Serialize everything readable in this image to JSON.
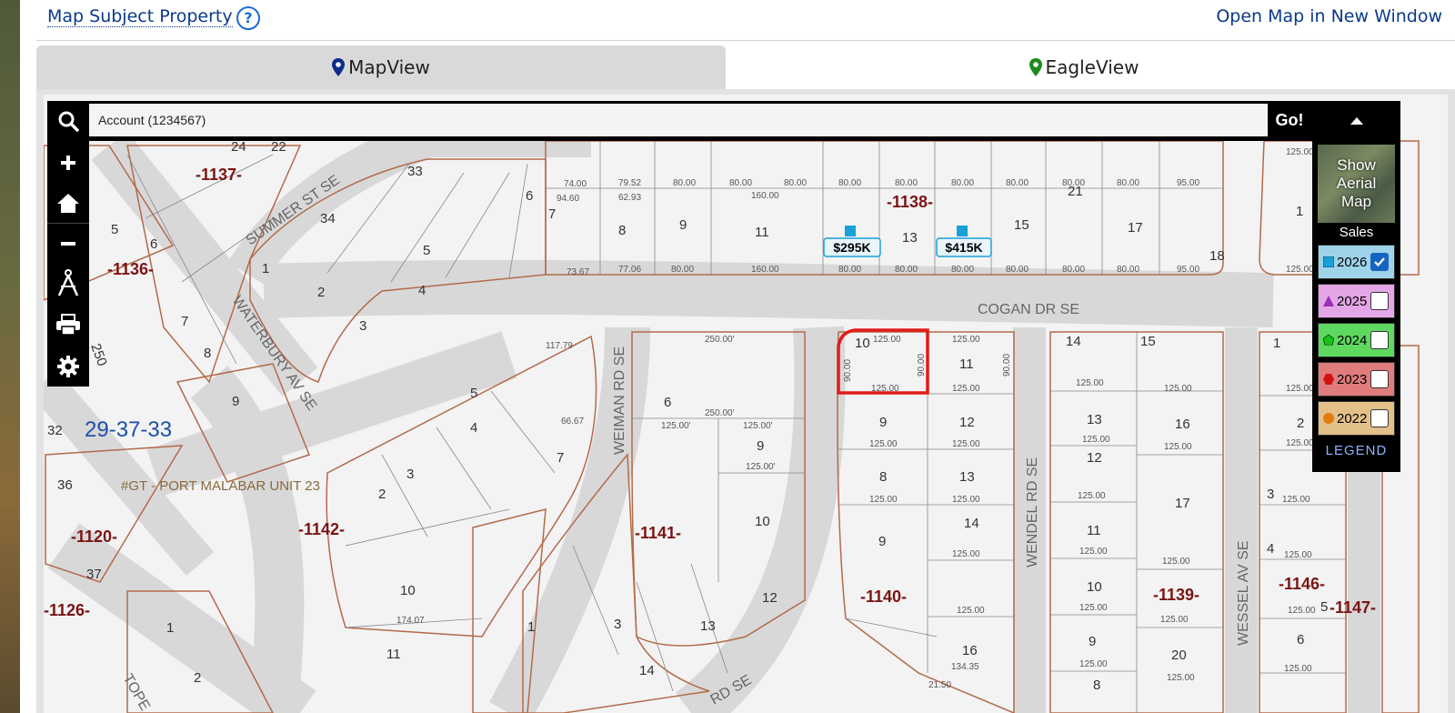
{
  "header": {
    "map_subject_label": "Map Subject Property",
    "help_glyph": "?",
    "open_new_window_label": "Open Map in New Window"
  },
  "tabs": [
    {
      "label": "MapView",
      "icon": "map-pin-icon",
      "color": "#0d2d8c",
      "active": true
    },
    {
      "label": "EagleView",
      "icon": "map-pin-icon",
      "color": "#1d8a1d",
      "active": false
    }
  ],
  "search": {
    "value": "Account (1234567)",
    "go_label": "Go!"
  },
  "toolbar": {
    "items": [
      "search-icon",
      "zoom-in-icon",
      "home-icon",
      "zoom-out-icon",
      "measure-icon",
      "print-icon",
      "gear-icon"
    ]
  },
  "right_panel": {
    "aerial_label_1": "Show",
    "aerial_label_2": "Aerial",
    "aerial_label_3": "Map",
    "sales_label": "Sales",
    "years": [
      {
        "year": "2026",
        "shape": "square",
        "marker_color": "#1aa0d8",
        "bg": "#9fd3ea",
        "checked": true
      },
      {
        "year": "2025",
        "shape": "triangle",
        "marker_color": "#9b2fb5",
        "bg": "#e4a6e6",
        "checked": false
      },
      {
        "year": "2024",
        "shape": "pentagon",
        "marker_color": "#15c415",
        "bg": "#5fd85f",
        "checked": false
      },
      {
        "year": "2023",
        "shape": "hexagon",
        "marker_color": "#d11313",
        "bg": "#e07c7c",
        "checked": false
      },
      {
        "year": "2022",
        "shape": "circle",
        "marker_color": "#e07c0c",
        "bg": "#e3c08a",
        "checked": false
      }
    ],
    "legend_label": "LEGEND"
  },
  "map": {
    "streets": [
      "SUMMER ST SE",
      "WATERBURY AV SE",
      "COGAN DR SE",
      "WEIMAN RD SE",
      "WENDEL RD SE",
      "WESSEL AV SE",
      "RD SE",
      "TOPE"
    ],
    "blocks": [
      "-1137-",
      "-1136-",
      "-1138-",
      "-1142-",
      "-1141-",
      "-1140-",
      "-1139-",
      "-1146-",
      "-1147-",
      "-1120-",
      "-1126-"
    ],
    "section_label": "29-37-33",
    "subdivision_label": "#GT - PORT MALABAR UNIT 23",
    "sale_tags": [
      "$295K",
      "$415K"
    ],
    "lot_labels": {
      "l1": "24",
      "l2": "22",
      "l3": "5",
      "l4": "6",
      "l5": "33",
      "l6": "34",
      "l7": "1",
      "l8": "2",
      "l9": "3",
      "l10": "4",
      "l11": "5",
      "l12": "6",
      "l13": "7",
      "l14": "8",
      "l15": "9",
      "l16": "11",
      "l17": "12",
      "l18": "13",
      "l19": "15",
      "l20": "21",
      "l21": "17",
      "l22": "18",
      "l23": "1",
      "l24": "7",
      "l25": "8",
      "l26": "9",
      "l27": "250",
      "l28": "10",
      "l29": "11",
      "l30": "9",
      "l31": "12",
      "l32": "8",
      "l33": "13",
      "l34": "9",
      "l35": "14",
      "l36": "16",
      "l37": "6",
      "l38": "9",
      "l39": "10",
      "l40": "7",
      "l41": "5",
      "l42": "4",
      "l43": "3",
      "l44": "2",
      "l45": "10",
      "l46": "11",
      "l47": "1",
      "l48": "3",
      "l49": "13",
      "l50": "14",
      "l51": "12",
      "l52": "14",
      "l53": "15",
      "l54": "13",
      "l55": "16",
      "l56": "12",
      "l57": "17",
      "l58": "11",
      "l59": "10",
      "l60": "9",
      "l61": "8",
      "l62": "20",
      "l63": "1",
      "l64": "2",
      "l65": "3",
      "l66": "4",
      "l67": "5",
      "l68": "6",
      "l69": "32",
      "l70": "36",
      "l71": "37",
      "l72": "1",
      "l73": "2"
    },
    "dims": {
      "d125": "125.00",
      "d80": "80.00",
      "d160": "160.00",
      "d250": "250.00'",
      "d7952": "79.52",
      "d6293": "62.93",
      "d7400": "74.00",
      "d9460": "94.60",
      "d7706": "77.06",
      "d9500": "95.00",
      "d7367": "73.67",
      "d11779": "117.79",
      "d6667": "66.67",
      "d17407": "174.07",
      "d13435": "134.35",
      "d2150": "21.50",
      "d9000": "90.00",
      "d12500p": "125.00'"
    }
  }
}
